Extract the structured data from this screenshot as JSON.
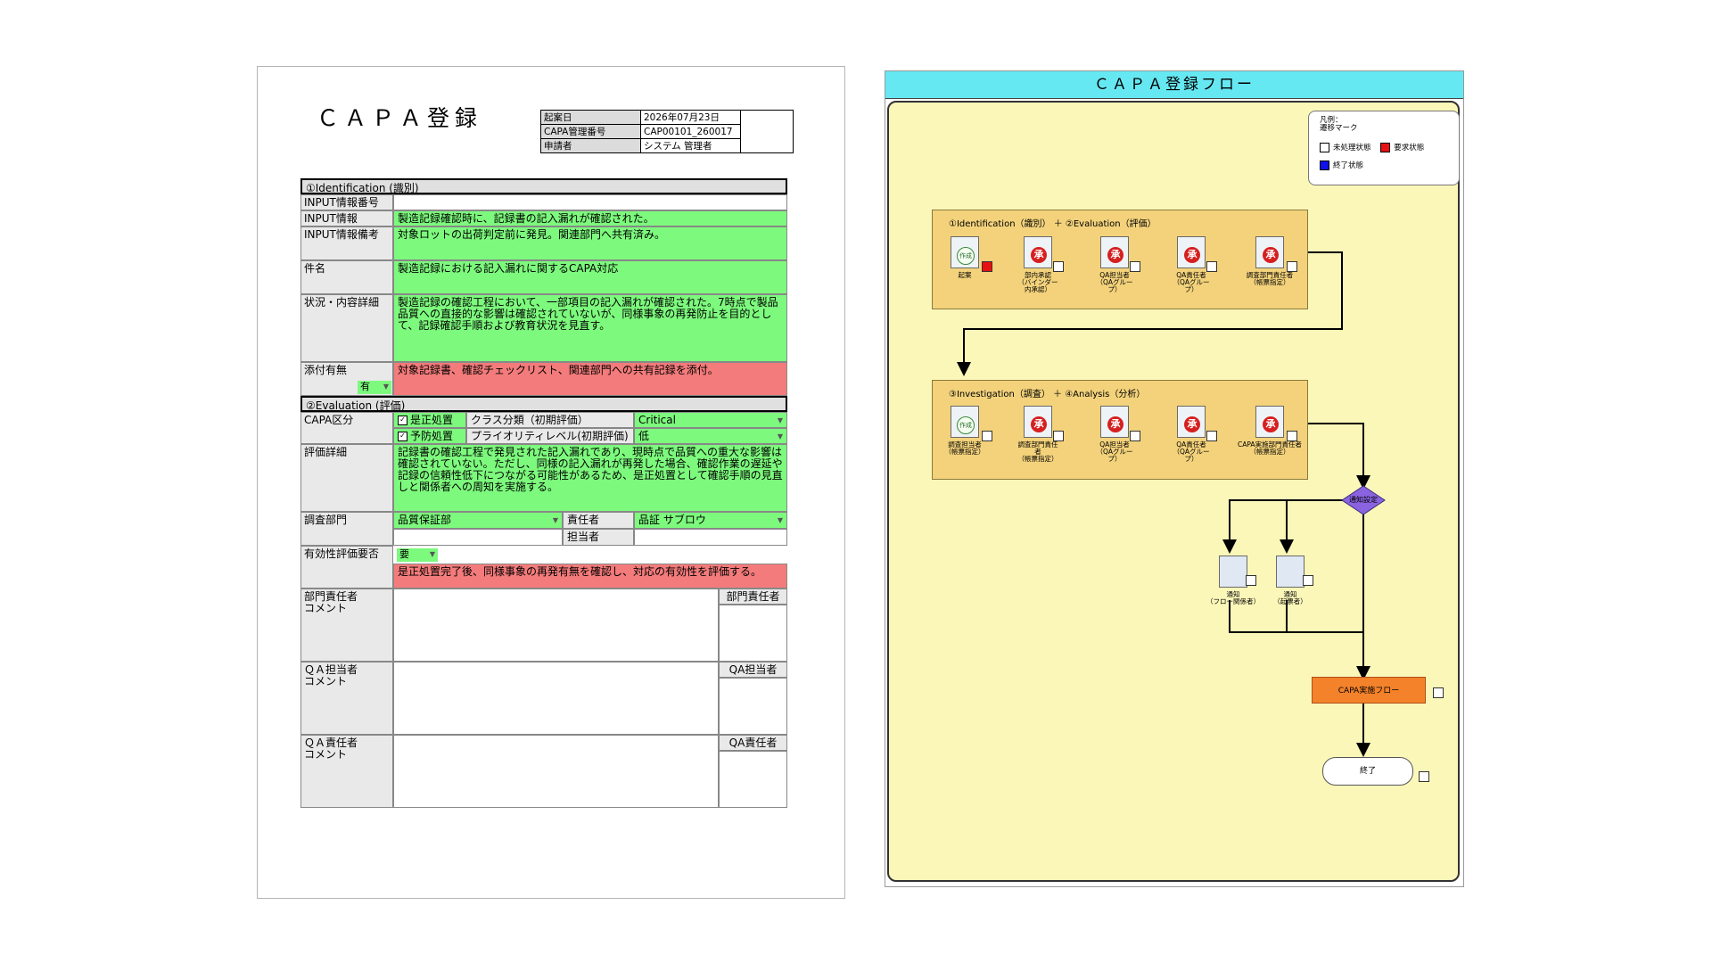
{
  "form": {
    "title": "ＣＡＰＡ登録",
    "header": [
      {
        "label": "起案日",
        "value": "2026年07月23日"
      },
      {
        "label": "CAPA管理番号",
        "value": "CAP00101_260017"
      },
      {
        "label": "申請者",
        "value": "システム 管理者"
      }
    ],
    "sec1": "①Identification (識別)",
    "input_no_label": "INPUT情報番号",
    "input_info_label": "INPUT情報",
    "input_info": "製造記録確認時に、記録書の記入漏れが確認された。",
    "input_note_label": "INPUT情報備考",
    "input_note": "対象ロットの出荷判定前に発見。関連部門へ共有済み。",
    "subject_label": "件名",
    "subject": "製造記録における記入漏れに関するCAPA対応",
    "status_label": "状況・内容詳細",
    "status": "製造記録の確認工程において、一部項目の記入漏れが確認された。7時点で製品品質への直接的な影響は確認されていないが、同様事象の再発防止を目的として、記録確認手順および教育状況を見直す。",
    "attach_label": "添付有無",
    "attach_value": "有",
    "attach_detail": "対象記録書、確認チェックリスト、関連部門への共有記録を添付。",
    "sec2": "②Evaluation (評価)",
    "capa_label": "CAPA区分",
    "corrective": "是正処置",
    "preventive": "予防処置",
    "class_label": "クラス分類（初期評価）",
    "class_value": "Critical",
    "priority_label": "プライオリティレベル(初期評価)",
    "priority_value": "低",
    "eval_label": "評価詳細",
    "eval_detail": "記録書の確認工程で発見された記入漏れであり、現時点で品質への重大な影響は確認されていない。ただし、同様の記入漏れが再発した場合、確認作業の遅延や記録の信頼性低下につながる可能性があるため、是正処置として確認手順の見直しと関係者への周知を実施する。",
    "dept_label": "調査部門",
    "dept_value": "品質保証部",
    "resp_label": "責任者",
    "resp_value": "品証 サブロウ",
    "tanto_label": "担当者",
    "eff_label": "有効性評価要否",
    "eff_value": "要",
    "eff_detail": "是正処置完了後、同様事象の再発有無を確認し、対応の有効性を評価する。",
    "comments": [
      {
        "label": "部門責任者\nコメント",
        "side": "部門責任者"
      },
      {
        "label": "ＱＡ担当者\nコメント",
        "side": "QA担当者"
      },
      {
        "label": "ＱＡ責任者\nコメント",
        "side": "QA責任者"
      }
    ]
  },
  "flow": {
    "title": "ＣＡＰＡ登録フロー",
    "legend": {
      "title1": "凡例：",
      "title2": "遷移マーク",
      "unprocessed": "未処理状態",
      "requested": "要求状態",
      "done": "終了状態"
    },
    "group1": {
      "title": "①Identification（識別） ＋ ②Evaluation（評価）",
      "nodes": [
        "起案",
        "部内承認\n（バインダー内承認）",
        "QA担当者\n（QAグループ）",
        "QA責任者\n（QAグループ）",
        "調査部門責任者\n（帳票指定）"
      ],
      "stamp_first": "作成",
      "stamp": "承"
    },
    "group2": {
      "title": "③Investigation（調査） ＋ ④Analysis（分析）",
      "nodes": [
        "調査担当者\n（帳票指定）",
        "調査部門責任者\n（帳票指定）",
        "QA担当者\n（QAグループ）",
        "QA責任者\n（QAグループ）",
        "CAPA実施部門責任者\n（帳票指定）"
      ],
      "stamp_first": "作成",
      "stamp": "承"
    },
    "notify_setting": "通知設定",
    "notify_nodes": [
      "通知\n（フロー関係者）",
      "通知\n（起票者）"
    ],
    "impl_flow": "CAPA実施フロー",
    "end": "終了"
  },
  "colors": {
    "green": "#7dfa7d",
    "red": "#f47b7b",
    "cyan": "#66e8f2",
    "flow_bg": "#fbf7b8",
    "group_bg": "#f3d27b"
  }
}
